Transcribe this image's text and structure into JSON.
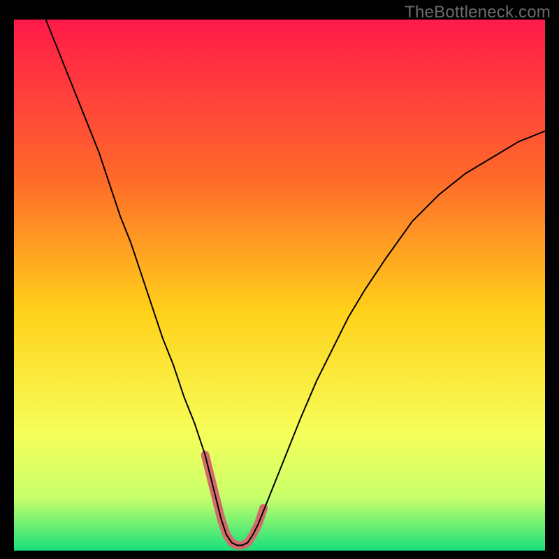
{
  "watermark": "TheBottleneck.com",
  "chart_data": {
    "type": "line",
    "title": "",
    "xlabel": "",
    "ylabel": "",
    "xlim": [
      0,
      100
    ],
    "ylim": [
      0,
      100
    ],
    "background_gradient": {
      "stops": [
        {
          "offset": 0.0,
          "color": "#ff1a4a"
        },
        {
          "offset": 0.3,
          "color": "#ff6a2a"
        },
        {
          "offset": 0.55,
          "color": "#ffd11a"
        },
        {
          "offset": 0.78,
          "color": "#f6ff5a"
        },
        {
          "offset": 0.9,
          "color": "#c8ff6a"
        },
        {
          "offset": 1.0,
          "color": "#18e07a"
        }
      ]
    },
    "series": [
      {
        "name": "curve",
        "color": "#000000",
        "stroke_width": 2,
        "x": [
          6,
          8,
          10,
          12,
          14,
          16,
          18,
          20,
          22,
          24,
          26,
          28,
          30,
          32,
          34,
          36,
          37,
          38,
          39,
          40,
          41,
          42,
          43,
          44,
          45,
          46,
          48,
          50,
          52,
          54,
          57,
          60,
          63,
          66,
          70,
          75,
          80,
          85,
          90,
          95,
          100
        ],
        "y": [
          100,
          95,
          90,
          85,
          80,
          75,
          69,
          63,
          58,
          52,
          46,
          40,
          35,
          29,
          24,
          18,
          14,
          10,
          6,
          3,
          1.5,
          1,
          1,
          1.5,
          3,
          5,
          10,
          15,
          20,
          25,
          32,
          38,
          44,
          49,
          55,
          62,
          67,
          71,
          74,
          77,
          79
        ]
      },
      {
        "name": "highlight-band",
        "color": "#d46b6b",
        "stroke_width": 12,
        "x": [
          36,
          37,
          38,
          39,
          40,
          41,
          42,
          43,
          44,
          45,
          46,
          47
        ],
        "y": [
          18,
          14,
          10,
          6,
          3,
          1.5,
          1,
          1,
          1.5,
          3,
          5,
          8
        ]
      }
    ]
  }
}
